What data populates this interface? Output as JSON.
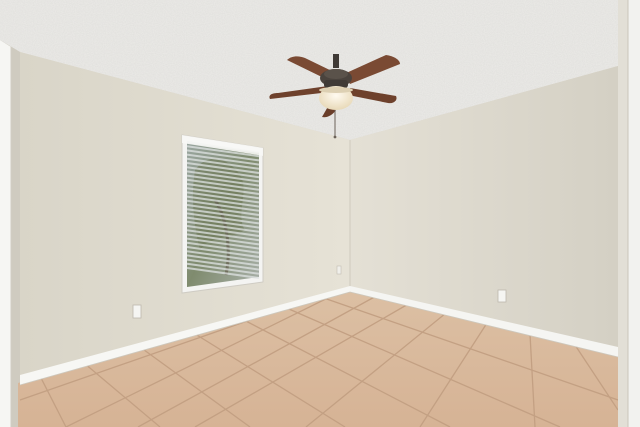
{
  "scene": {
    "description_colors": {
      "ceiling": "#ecebe8",
      "left_wall": "#e1ddd1",
      "right_wall": "#dcd8cc",
      "baseboard": "#f7f7f4",
      "floor_tile": "#d9b79a",
      "grout": "#c4a185",
      "fan_blade": "#7a4a33",
      "fan_metal": "#3f3a36",
      "fan_light": "#f4ecd6",
      "window_frame": "#f4f4f2",
      "blind_slat": "#e9ecec"
    }
  }
}
